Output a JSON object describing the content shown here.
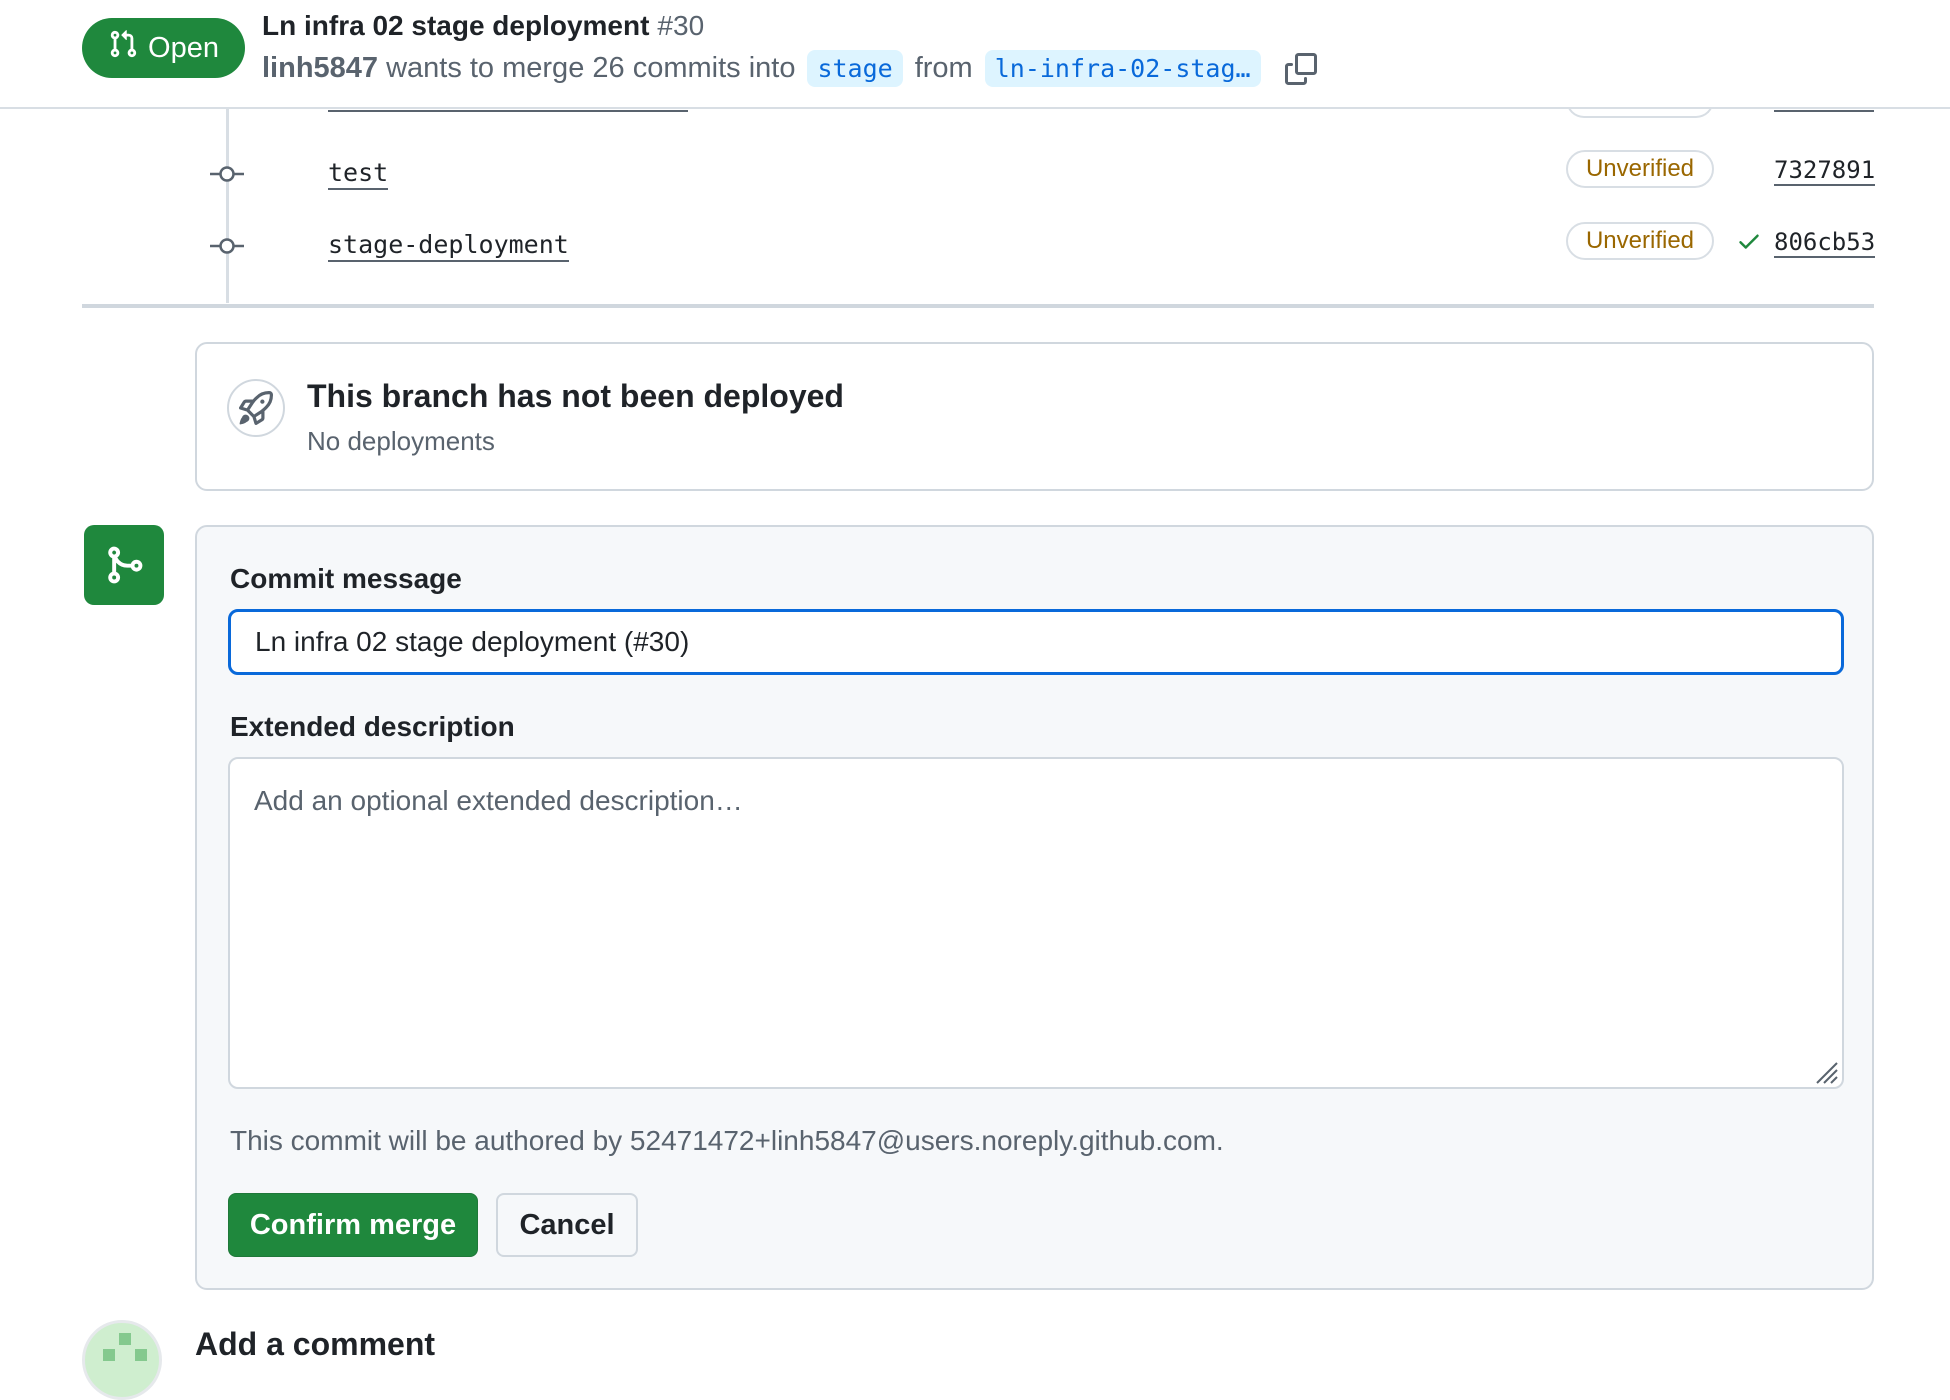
{
  "header": {
    "state": "Open",
    "title": "Ln infra 02 stage deployment",
    "number": "#30",
    "author": "linh5847",
    "merge_text": "wants to merge 26 commits into",
    "base_branch": "stage",
    "from_text": "from",
    "head_branch": "ln-infra-02-stag…"
  },
  "commits": [
    {
      "message": "test",
      "verification": "Unverified",
      "sha": "7327891",
      "ci_status": ""
    },
    {
      "message": "stage-deployment",
      "verification": "Unverified",
      "sha": "806cb53",
      "ci_status": "success"
    }
  ],
  "deployment": {
    "title": "This branch has not been deployed",
    "subtitle": "No deployments"
  },
  "merge_form": {
    "commit_label": "Commit message",
    "commit_value": "Ln infra 02 stage deployment (#30)",
    "description_label": "Extended description",
    "description_placeholder": "Add an optional extended description…",
    "author_note": "This commit will be authored by 52471472+linh5847@users.noreply.github.com.",
    "confirm_label": "Confirm merge",
    "cancel_label": "Cancel"
  },
  "comment": {
    "title": "Add a comment"
  },
  "colors": {
    "success_green": "#1f883d",
    "focus_blue": "#0969da",
    "unverified_text": "#9a6700",
    "branch_chip_bg": "#ddf4ff"
  }
}
